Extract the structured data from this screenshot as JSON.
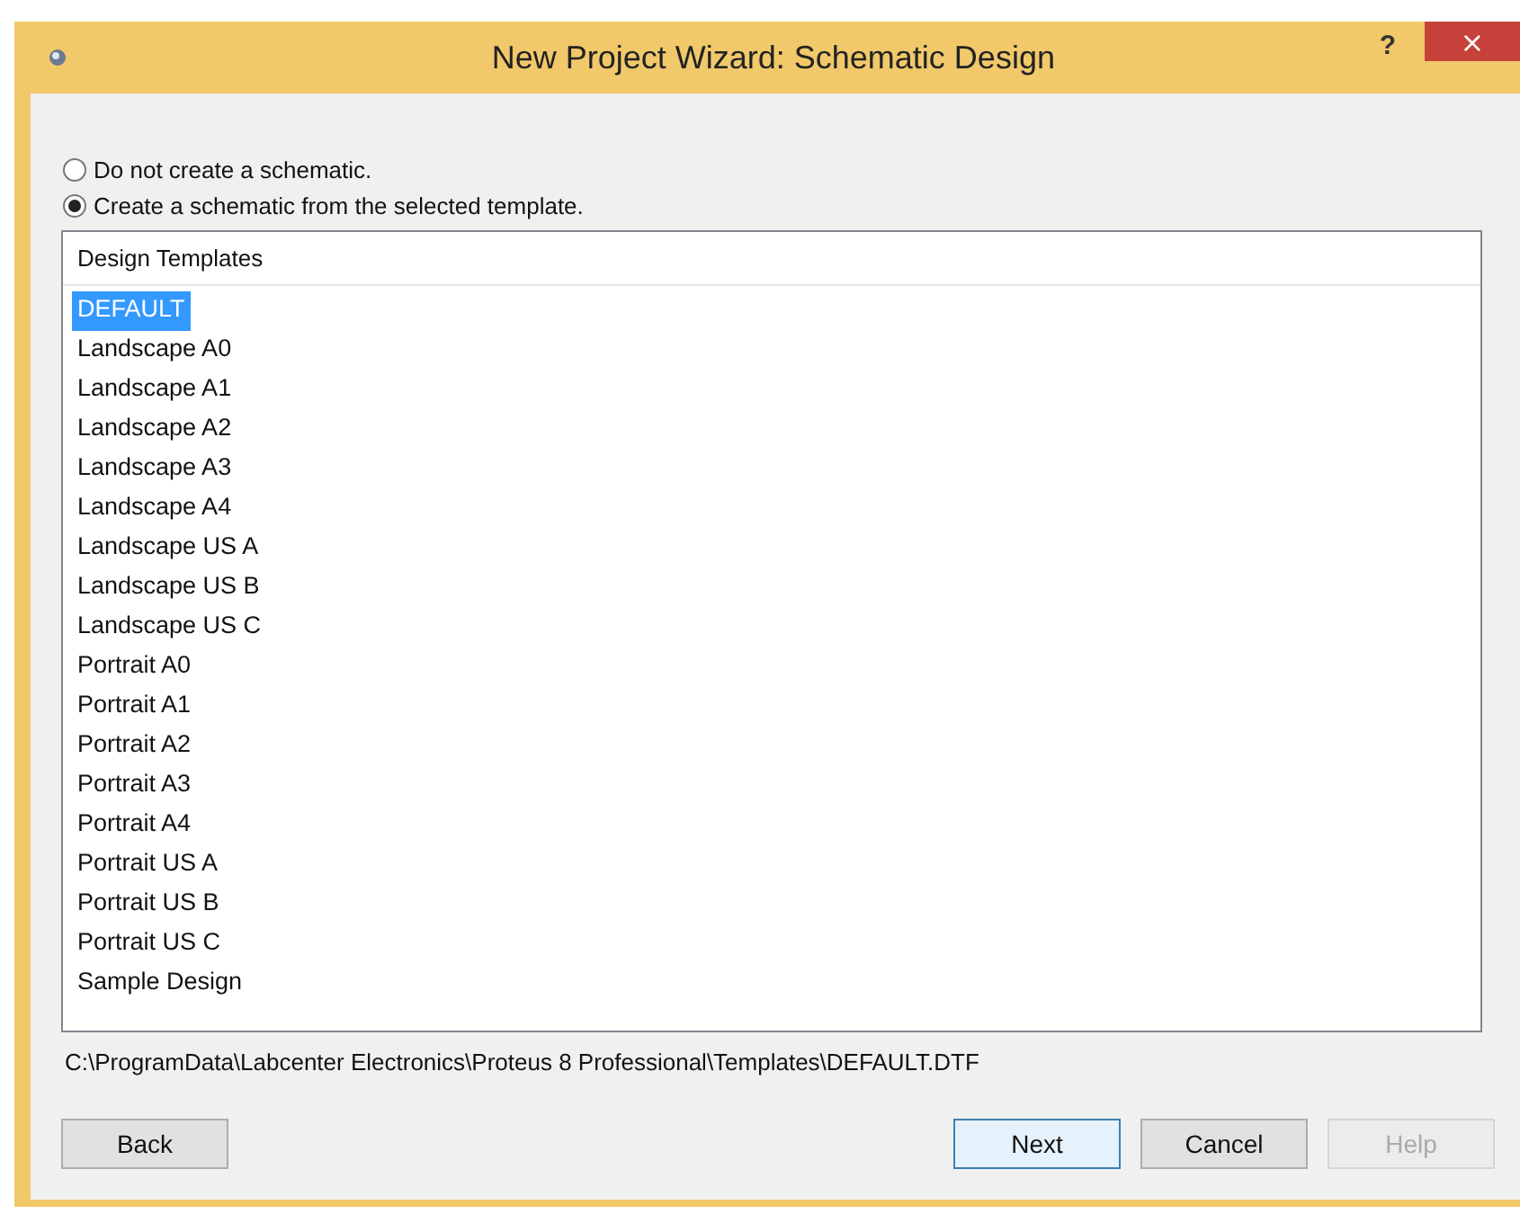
{
  "window": {
    "title": "New Project Wizard: Schematic Design",
    "help": "?",
    "close": "×"
  },
  "options": [
    {
      "label": "Do not create a schematic.",
      "selected": false
    },
    {
      "label": "Create a schematic from the selected template.",
      "selected": true
    }
  ],
  "templates": {
    "header": "Design Templates",
    "items": [
      {
        "label": "DEFAULT",
        "selected": true
      },
      {
        "label": "Landscape A0",
        "selected": false
      },
      {
        "label": "Landscape A1",
        "selected": false
      },
      {
        "label": "Landscape A2",
        "selected": false
      },
      {
        "label": "Landscape A3",
        "selected": false
      },
      {
        "label": "Landscape A4",
        "selected": false
      },
      {
        "label": "Landscape US A",
        "selected": false
      },
      {
        "label": "Landscape US B",
        "selected": false
      },
      {
        "label": "Landscape US C",
        "selected": false
      },
      {
        "label": "Portrait A0",
        "selected": false
      },
      {
        "label": "Portrait A1",
        "selected": false
      },
      {
        "label": "Portrait A2",
        "selected": false
      },
      {
        "label": "Portrait A3",
        "selected": false
      },
      {
        "label": "Portrait A4",
        "selected": false
      },
      {
        "label": "Portrait US A",
        "selected": false
      },
      {
        "label": "Portrait US B",
        "selected": false
      },
      {
        "label": "Portrait US C",
        "selected": false
      },
      {
        "label": "Sample Design",
        "selected": false
      }
    ]
  },
  "path": "C:\\ProgramData\\Labcenter Electronics\\Proteus 8 Professional\\Templates\\DEFAULT.DTF",
  "buttons": [
    {
      "label": "Back",
      "kind": "left",
      "disabled": false,
      "default": false
    },
    {
      "label": "Next",
      "kind": "right",
      "disabled": false,
      "default": true
    },
    {
      "label": "Cancel",
      "kind": "right",
      "disabled": false,
      "default": false
    },
    {
      "label": "Help",
      "kind": "right",
      "disabled": true,
      "default": false
    }
  ]
}
